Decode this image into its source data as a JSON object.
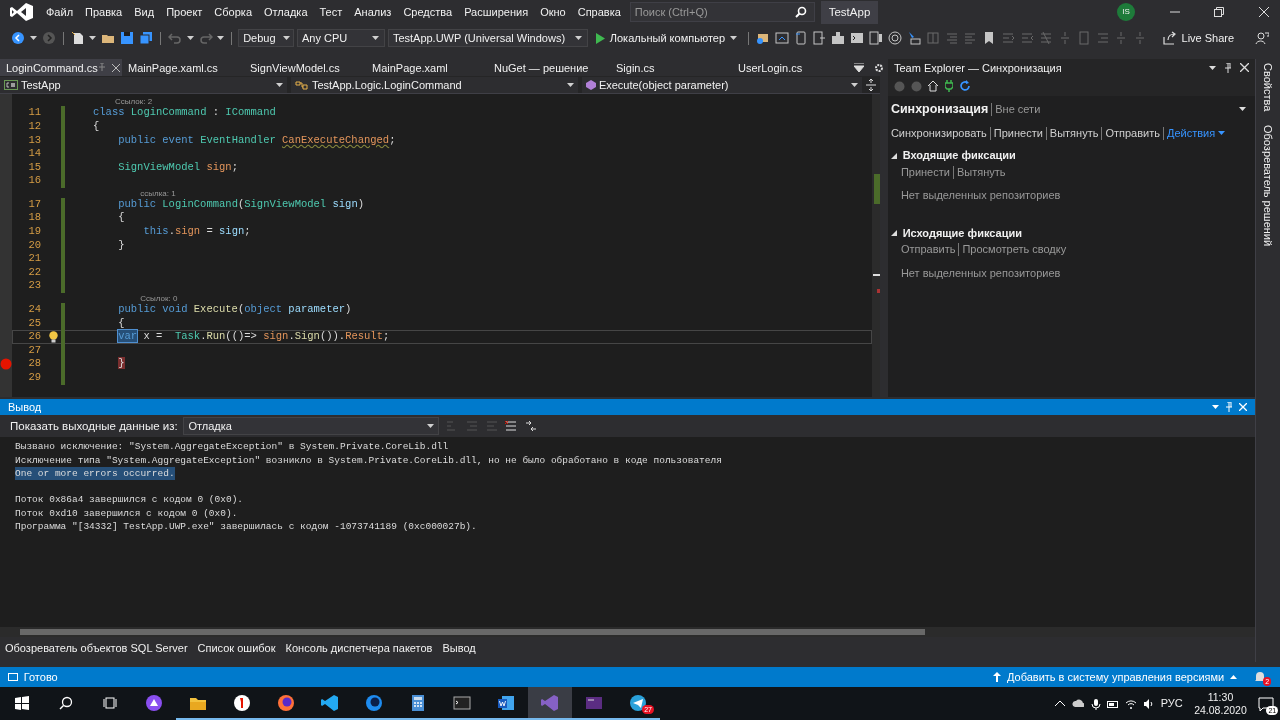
{
  "title_bar": {
    "menu": [
      "Файл",
      "Правка",
      "Вид",
      "Проект",
      "Сборка",
      "Отладка",
      "Тест",
      "Анализ",
      "Средства",
      "Расширения",
      "Окно",
      "Справка"
    ],
    "search": {
      "placeholder": "Поиск (Ctrl+Q)"
    },
    "solution": "TestApp",
    "avatar": "IS"
  },
  "toolbar": {
    "configuration": "Debug",
    "platform": "Any CPU",
    "startup_project": "TestApp.UWP (Universal Windows)",
    "run_target": "Локальный компьютер",
    "live_share": "Live Share"
  },
  "doc_tabs": [
    {
      "label": "LoginCommand.cs",
      "selected": true
    },
    {
      "label": "MainPage.xaml.cs",
      "selected": false
    },
    {
      "label": "SignViewModel.cs",
      "selected": false
    },
    {
      "label": "MainPage.xaml",
      "selected": false
    },
    {
      "label": "NuGet — решение",
      "selected": false
    },
    {
      "label": "Sigin.cs",
      "selected": false
    },
    {
      "label": "UserLogin.cs",
      "selected": false
    }
  ],
  "nav_bar": {
    "project": "TestApp",
    "type": "TestApp.Logic.LoginCommand",
    "member": "Execute(object parameter)"
  },
  "code": {
    "lines": [
      {
        "kind": "lens",
        "text": "Ссылок: 2"
      },
      {
        "kind": "code",
        "number": "11",
        "tokens": [
          {
            "text": "class",
            "kind": "keyword"
          },
          {
            "text": " LoginCommand",
            "kind": "type"
          },
          {
            "text": " : ",
            "kind": "plain"
          },
          {
            "text": "ICommand",
            "kind": "type"
          }
        ]
      },
      {
        "kind": "code",
        "number": "12",
        "tokens": [
          {
            "text": "{",
            "kind": "plain"
          }
        ]
      },
      {
        "kind": "code",
        "number": "13",
        "tokens": [
          {
            "text": "    public event",
            "kind": "keyword"
          },
          {
            "text": " EventHandler ",
            "kind": "type"
          },
          {
            "text": "CanExecuteChanged",
            "kind": "member",
            "squiggle": true
          },
          {
            "text": ";",
            "kind": "plain"
          }
        ]
      },
      {
        "kind": "code",
        "number": "14"
      },
      {
        "kind": "code",
        "number": "15",
        "tokens": [
          {
            "text": "    SignViewModel",
            "kind": "type"
          },
          {
            "text": " sign",
            "kind": "member"
          },
          {
            "text": ";",
            "kind": "plain"
          }
        ]
      },
      {
        "kind": "code",
        "number": "16"
      },
      {
        "kind": "lens",
        "text": "    ссылка: 1"
      },
      {
        "kind": "code",
        "number": "17",
        "tokens": [
          {
            "text": "    public",
            "kind": "keyword"
          },
          {
            "text": " LoginCommand",
            "kind": "type"
          },
          {
            "text": "(",
            "kind": "plain"
          },
          {
            "text": "SignViewModel",
            "kind": "type"
          },
          {
            "text": " sign",
            "kind": "param"
          },
          {
            "text": ")",
            "kind": "plain"
          }
        ]
      },
      {
        "kind": "code",
        "number": "18",
        "tokens": [
          {
            "text": "    {",
            "kind": "plain"
          }
        ]
      },
      {
        "kind": "code",
        "number": "19",
        "tokens": [
          {
            "text": "        this",
            "kind": "keyword"
          },
          {
            "text": ".",
            "kind": "plain"
          },
          {
            "text": "sign",
            "kind": "member"
          },
          {
            "text": " = ",
            "kind": "plain"
          },
          {
            "text": "sign",
            "kind": "param"
          },
          {
            "text": ";",
            "kind": "plain"
          }
        ]
      },
      {
        "kind": "code",
        "number": "20",
        "tokens": [
          {
            "text": "    }",
            "kind": "plain"
          }
        ]
      },
      {
        "kind": "code",
        "number": "21"
      },
      {
        "kind": "code",
        "number": "22"
      },
      {
        "kind": "code",
        "number": "23"
      },
      {
        "kind": "lens",
        "text": "    Ссылок: 0"
      },
      {
        "kind": "code",
        "number": "24",
        "tokens": [
          {
            "text": "    public void",
            "kind": "keyword"
          },
          {
            "text": " Execute",
            "kind": "method"
          },
          {
            "text": "(",
            "kind": "plain"
          },
          {
            "text": "object",
            "kind": "keyword"
          },
          {
            "text": " parameter",
            "kind": "param"
          },
          {
            "text": ")",
            "kind": "plain"
          }
        ]
      },
      {
        "kind": "code",
        "number": "25",
        "tokens": [
          {
            "text": "    {",
            "kind": "plain"
          }
        ]
      },
      {
        "kind": "code",
        "number": "26",
        "current": true,
        "lightbulb": true,
        "tokens": [
          {
            "text": "var",
            "kind": "keyword",
            "highlight": true,
            "indented": true
          },
          {
            "text": " x =  ",
            "kind": "plain"
          },
          {
            "text": "Task",
            "kind": "type"
          },
          {
            "text": ".",
            "kind": "plain"
          },
          {
            "text": "Run",
            "kind": "method"
          },
          {
            "text": "(()=> ",
            "kind": "plain"
          },
          {
            "text": "sign",
            "kind": "member"
          },
          {
            "text": ".",
            "kind": "plain"
          },
          {
            "text": "Sign",
            "kind": "method"
          },
          {
            "text": "()).",
            "kind": "plain"
          },
          {
            "text": "Result",
            "kind": "member"
          },
          {
            "text": ";",
            "kind": "plain"
          }
        ]
      },
      {
        "kind": "code",
        "number": "27"
      },
      {
        "kind": "code",
        "number": "28",
        "breakpoint": true,
        "tokens": [
          {
            "text": "}",
            "kind": "brace",
            "highlight": true,
            "indented": true
          }
        ]
      },
      {
        "kind": "code",
        "number": "29"
      }
    ]
  },
  "team_explorer": {
    "title": "Team Explorer — Синхронизация",
    "page": "Синхронизация",
    "status": "Вне сети",
    "actions": [
      {
        "label": "Синхронизировать",
        "kind": "link"
      },
      {
        "label": "Принести",
        "kind": "link"
      },
      {
        "label": "Вытянуть",
        "kind": "link"
      },
      {
        "label": "Отправить",
        "kind": "link"
      },
      {
        "label": "Действия",
        "kind": "menu"
      }
    ],
    "sections": [
      {
        "title": "Входящие фиксации",
        "expanded": true,
        "links": [
          "Принести",
          "Вытянуть"
        ],
        "message": "Нет выделенных репозиториев"
      },
      {
        "title": "Исходящие фиксации",
        "expanded": true,
        "links": [
          "Отправить",
          "Просмотреть сводку"
        ],
        "message": "Нет выделенных репозиториев"
      }
    ]
  },
  "side_tabs": [
    "Свойства",
    "Обозреватель решений"
  ],
  "output": {
    "title": "Вывод",
    "source_label": "Показать выходные данные из:",
    "source": "Отладка",
    "lines": [
      {
        "text": "Вызвано исключение: \"System.AggregateException\" в System.Private.CoreLib.dll",
        "selected": false
      },
      {
        "text": "Исключение типа \"System.AggregateException\" возникло в System.Private.CoreLib.dll, но не было обработано в коде пользователя",
        "selected": false
      },
      {
        "text": "One or more errors occurred.",
        "selected": true
      },
      {
        "text": "Поток 0x86a4 завершился с кодом 0 (0x0).",
        "selected": false,
        "gap_before": true
      },
      {
        "text": "Поток 0xd10 завершился с кодом 0 (0x0).",
        "selected": false
      },
      {
        "text": "Программа \"[34332] TestApp.UWP.exe\" завершилась с кодом -1073741189 (0xc000027b).",
        "selected": false
      }
    ]
  },
  "bottom_tabs": [
    "Обозреватель объектов SQL Server",
    "Список ошибок",
    "Консоль диспетчера пакетов",
    "Вывод"
  ],
  "status_bar": {
    "text": "Готово",
    "source_control": "Добавить в систему управления версиями",
    "notifications": "2"
  },
  "taskbar": {
    "apps": [
      {
        "kind": "assistant",
        "running": false,
        "selected": false
      },
      {
        "kind": "folder",
        "running": true,
        "selected": false
      },
      {
        "kind": "yandex",
        "running": true,
        "selected": false
      },
      {
        "kind": "firefox",
        "running": true,
        "selected": false
      },
      {
        "kind": "vscode",
        "running": true,
        "selected": false
      },
      {
        "kind": "firefox-dev",
        "running": true,
        "selected": false
      },
      {
        "kind": "calculator",
        "running": true,
        "selected": false
      },
      {
        "kind": "terminal",
        "running": true,
        "selected": false
      },
      {
        "kind": "word",
        "running": true,
        "selected": false
      },
      {
        "kind": "visualstudio",
        "running": true,
        "selected": true
      },
      {
        "kind": "console",
        "running": true,
        "selected": false
      },
      {
        "kind": "telegram",
        "running": true,
        "selected": false,
        "badge": "27"
      }
    ],
    "language": "РУС",
    "time": "11:30",
    "date": "24.08.2020",
    "action_center": "21"
  }
}
